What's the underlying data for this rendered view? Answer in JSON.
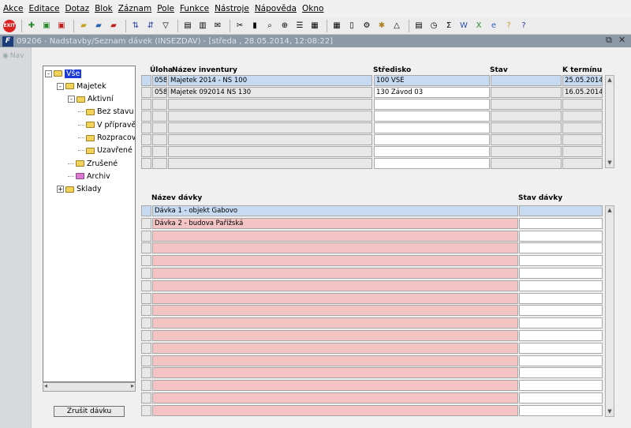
{
  "menu": [
    "Akce",
    "Editace",
    "Dotaz",
    "Blok",
    "Záznam",
    "Pole",
    "Funkce",
    "Nástroje",
    "Nápověda",
    "Okno"
  ],
  "toolbar": {
    "exit_label": "EXIT"
  },
  "window": {
    "title": "09206 - Nadstavby/Seznam dávek (INSEZDAV) - [středa , 28.05.2014, 12:08:22]"
  },
  "nav": {
    "label": "Nav"
  },
  "tree": [
    {
      "label": "Vše",
      "depth": 0,
      "expander": "-",
      "selected": true
    },
    {
      "label": "Majetek",
      "depth": 1,
      "expander": "-"
    },
    {
      "label": "Aktivní",
      "depth": 2,
      "expander": "-"
    },
    {
      "label": "Bez stavu",
      "depth": 3
    },
    {
      "label": "V přípravě",
      "depth": 3
    },
    {
      "label": "Rozpracovaná",
      "depth": 3
    },
    {
      "label": "Uzavřené",
      "depth": 3
    },
    {
      "label": "Zrušené",
      "depth": 2
    },
    {
      "label": "Archiv",
      "depth": 2,
      "pink": true
    },
    {
      "label": "Sklady",
      "depth": 1,
      "expander": "+"
    }
  ],
  "buttons": {
    "cancel_batch": "Zrušit dávku"
  },
  "inventory": {
    "headers": {
      "task": "Úloha",
      "name": "Název inventury",
      "center": "Středisko",
      "state": "Stav",
      "due": "K termínu"
    },
    "rows": [
      {
        "task": "058",
        "name": "Majetek 2014 - NS 100",
        "center": "100 VSE",
        "state": "",
        "due": "25.05.2014"
      },
      {
        "task": "058",
        "name": "Majetek 092014 NS 130",
        "center": "130 Závod 03",
        "state": "",
        "due": "16.05.2014"
      }
    ],
    "visible_rows": 8
  },
  "batches": {
    "headers": {
      "name": "Název dávky",
      "state": "Stav dávky"
    },
    "rows": [
      {
        "name": "Dávka 1 - objekt Gabovo",
        "state": ""
      },
      {
        "name": "Dávka 2 - budova Pařížská",
        "state": ""
      }
    ],
    "visible_rows": 17
  },
  "colors": {
    "selected_row": "#c6daf2",
    "batch_row": "#f4c3c3",
    "grid_row": "#e8e8e8",
    "titlebar": "#8c99a6"
  }
}
